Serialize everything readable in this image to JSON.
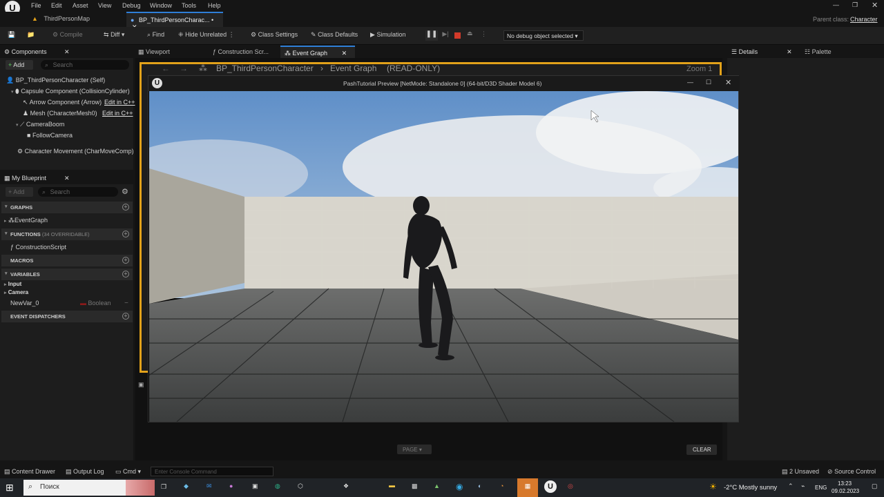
{
  "menubar": {
    "items": [
      "File",
      "Edit",
      "Asset",
      "View",
      "Debug",
      "Window",
      "Tools",
      "Help"
    ],
    "parent_class_label": "Parent class:",
    "parent_class_value": "Character"
  },
  "tabs": [
    {
      "label": "ThirdPersonMap"
    },
    {
      "label": "BP_ThirdPersonCharac... •"
    }
  ],
  "toolbar": {
    "compile": "Compile",
    "diff": "Diff",
    "find": "Find",
    "hide_unrelated": "Hide Unrelated",
    "class_settings": "Class Settings",
    "class_defaults": "Class Defaults",
    "simulation": "Simulation",
    "debug_object": "No debug object selected"
  },
  "components": {
    "title": "Components",
    "add": "Add",
    "search_placeholder": "Search",
    "items": [
      {
        "label": "BP_ThirdPersonCharacter (Self)"
      },
      {
        "label": "Capsule Component (CollisionCylinder)"
      },
      {
        "label": "Arrow Component (Arrow)",
        "link": "Edit in C++"
      },
      {
        "label": "Mesh (CharacterMesh0)",
        "link": "Edit in C++"
      },
      {
        "label": "CameraBoom"
      },
      {
        "label": "FollowCamera"
      },
      {
        "label": "Character Movement (CharMoveComp)"
      }
    ]
  },
  "my_blueprint": {
    "title": "My Blueprint",
    "add": "Add",
    "search_placeholder": "Search",
    "graphs_header": "GRAPHS",
    "event_graph": "EventGraph",
    "functions_header": "FUNCTIONS",
    "functions_count": "(34 OVERRIDABLE)",
    "construction_script": "ConstructionScript",
    "macros_header": "MACROS",
    "variables_header": "VARIABLES",
    "var_input": "Input",
    "var_camera": "Camera",
    "new_var": "NewVar_0",
    "new_var_type": "Boolean",
    "dispatchers_header": "EVENT DISPATCHERS"
  },
  "editor_tabs": [
    "Viewport",
    "Construction Scr...",
    "Event Graph"
  ],
  "breadcrumb": {
    "blueprint": "BP_ThirdPersonCharacter",
    "graph": "Event Graph",
    "mode": "(READ-ONLY)",
    "zoom": "Zoom 1"
  },
  "right_tabs": {
    "details": "Details",
    "palette": "Palette"
  },
  "game_window": {
    "title": "PashTutorial Preview [NetMode: Standalone 0]  (64-bit/D3D Shader Model 6)"
  },
  "bottom": {
    "page": "PAGE",
    "clear": "CLEAR",
    "content_drawer": "Content Drawer",
    "output_log": "Output Log",
    "cmd": "Cmd",
    "console_placeholder": "Enter Console Command",
    "unsaved": "2 Unsaved",
    "source_control": "Source Control"
  },
  "taskbar": {
    "search": "Поиск",
    "weather": "-2°C  Mostly sunny",
    "lang": "ENG",
    "time": "13:23",
    "date": "09.02.2023"
  },
  "colors": {
    "accent_orange": "#e3a21a",
    "stop_red": "#d23a2a",
    "tab_active_blue": "#2f7fd8"
  }
}
